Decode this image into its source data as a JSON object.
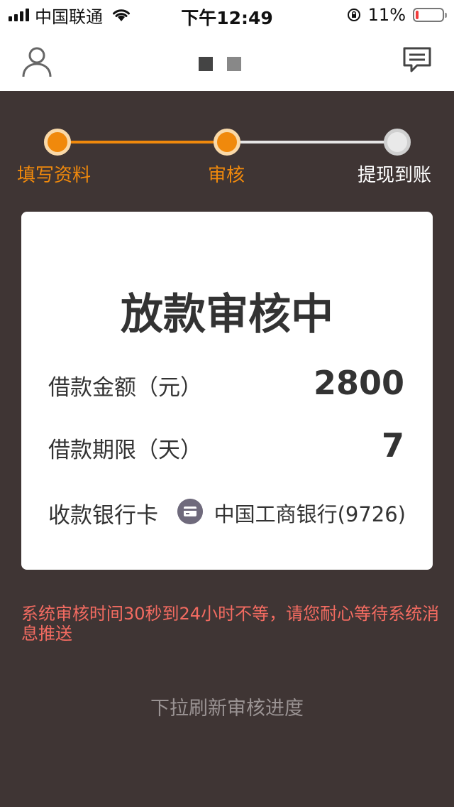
{
  "status_bar": {
    "carrier": "中国联通",
    "time": "下午12:49",
    "battery_percent": "11%",
    "battery_level": 0.11,
    "battery_color": "#f23d3d"
  },
  "navbar": {
    "left_icon": "profile-icon",
    "right_icon": "message-icon",
    "page_dots": [
      "#444444",
      "#888888"
    ]
  },
  "progress": {
    "accent_color": "#f0890c",
    "steps": [
      {
        "label": "填写资料",
        "state": "done"
      },
      {
        "label": "审核",
        "state": "current"
      },
      {
        "label": "提现到账",
        "state": "pending"
      }
    ]
  },
  "card": {
    "title": "放款审核中",
    "loan_amount": {
      "label": "借款金额（元）",
      "value": "2800"
    },
    "loan_term": {
      "label": "借款期限（天）",
      "value": "7"
    },
    "bank": {
      "label": "收款银行卡",
      "icon": "bank-card-icon",
      "value": "中国工商银行(9726)"
    }
  },
  "notice": "系统审核时间30秒到24小时不等，请您耐心等待系统消息推送",
  "pull_refresh": "下拉刷新审核进度"
}
